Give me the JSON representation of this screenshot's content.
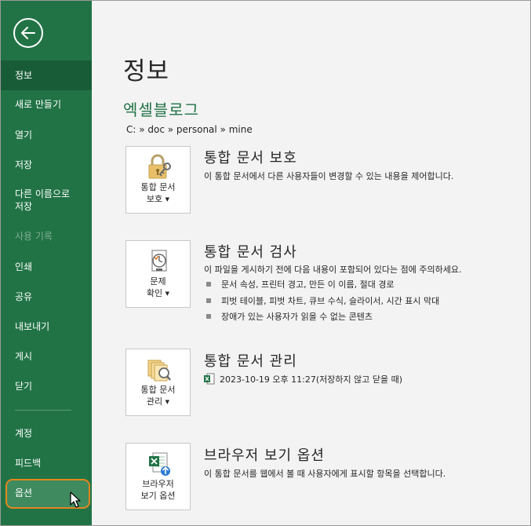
{
  "sidebar": {
    "items": [
      {
        "label": "정보"
      },
      {
        "label": "새로 만들기"
      },
      {
        "label": "열기"
      },
      {
        "label": "저장"
      },
      {
        "label": "다른 이름으로\n저장"
      },
      {
        "label": "사용 기록"
      },
      {
        "label": "인쇄"
      },
      {
        "label": "공유"
      },
      {
        "label": "내보내기"
      },
      {
        "label": "게시"
      },
      {
        "label": "닫기"
      },
      {
        "label": "계정"
      },
      {
        "label": "피드백"
      },
      {
        "label": "옵션"
      }
    ],
    "active": "정보",
    "disabled": "사용 기록",
    "highlighted": "옵션"
  },
  "main": {
    "page_title": "정보",
    "doc_name": "엑셀블로그",
    "doc_path": "C: » doc » personal » mine",
    "sections": [
      {
        "button_label": "통합 문서\n보호",
        "icon": "lock-key-icon",
        "title": "통합 문서 보호",
        "desc": "이 통합 문서에서 다른 사용자들이 변경할 수 있는 내용을 제어합니다."
      },
      {
        "button_label": "문제\n확인",
        "icon": "inspect-document-icon",
        "title": "통합 문서 검사",
        "desc": "이 파일을 게시하기 전에 다음 내용이 포함되어 있다는 점에 주의하세요.",
        "bullets": [
          "문서 속성, 프린터 경고, 만든 이 이름, 절대 경로",
          "피벗 테이블, 피벗 차트, 큐브 수식, 슬라이서, 시간 표시 막대",
          "장애가 있는 사용자가 읽을 수 없는 콘텐츠"
        ]
      },
      {
        "button_label": "통합 문서\n관리",
        "icon": "manage-workbook-icon",
        "title": "통합 문서 관리",
        "version": "2023-10-19 오후 11:27(저장하지 않고 닫을 때)"
      },
      {
        "button_label": "브라우저\n보기 옵션",
        "icon": "browser-view-icon",
        "title": "브라우저 보기 옵션",
        "desc": "이 통합 문서를 웹에서 볼 때 사용자에게 표시할 항목을 선택합니다."
      }
    ]
  },
  "colors": {
    "sidebar": "#217346",
    "sidebar_active": "#185c37",
    "accent": "#217346",
    "highlight_border": "#e3861e"
  }
}
